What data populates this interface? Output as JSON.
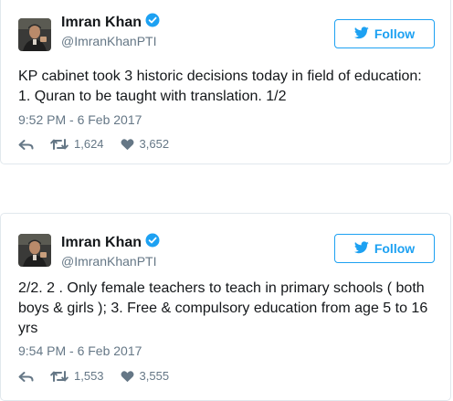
{
  "colors": {
    "accent": "#1da1f2",
    "muted_text": "#657786",
    "text": "#14171a",
    "border": "#e1e8ed"
  },
  "tweets": [
    {
      "name": "Imran Khan",
      "handle": "@ImranKhanPTI",
      "verified_icon": "verified-badge-icon",
      "follow_label": "Follow",
      "text": "KP cabinet took 3 historic decisions today in field of education:\n1. Quran to be taught with translation. 1/2",
      "timestamp": "9:52 PM - 6 Feb 2017",
      "actions": {
        "reply_icon": "reply-icon",
        "retweet_icon": "retweet-icon",
        "retweets": "1,624",
        "like_icon": "heart-icon",
        "likes": "3,652"
      }
    },
    {
      "name": "Imran Khan",
      "handle": "@ImranKhanPTI",
      "verified_icon": "verified-badge-icon",
      "follow_label": "Follow",
      "text": "2/2. 2 . Only female teachers to teach in primary schools ( both boys & girls ); 3. Free & compulsory education from age 5 to 16 yrs",
      "timestamp": "9:54 PM - 6 Feb 2017",
      "actions": {
        "reply_icon": "reply-icon",
        "retweet_icon": "retweet-icon",
        "retweets": "1,553",
        "like_icon": "heart-icon",
        "likes": "3,555"
      }
    }
  ]
}
